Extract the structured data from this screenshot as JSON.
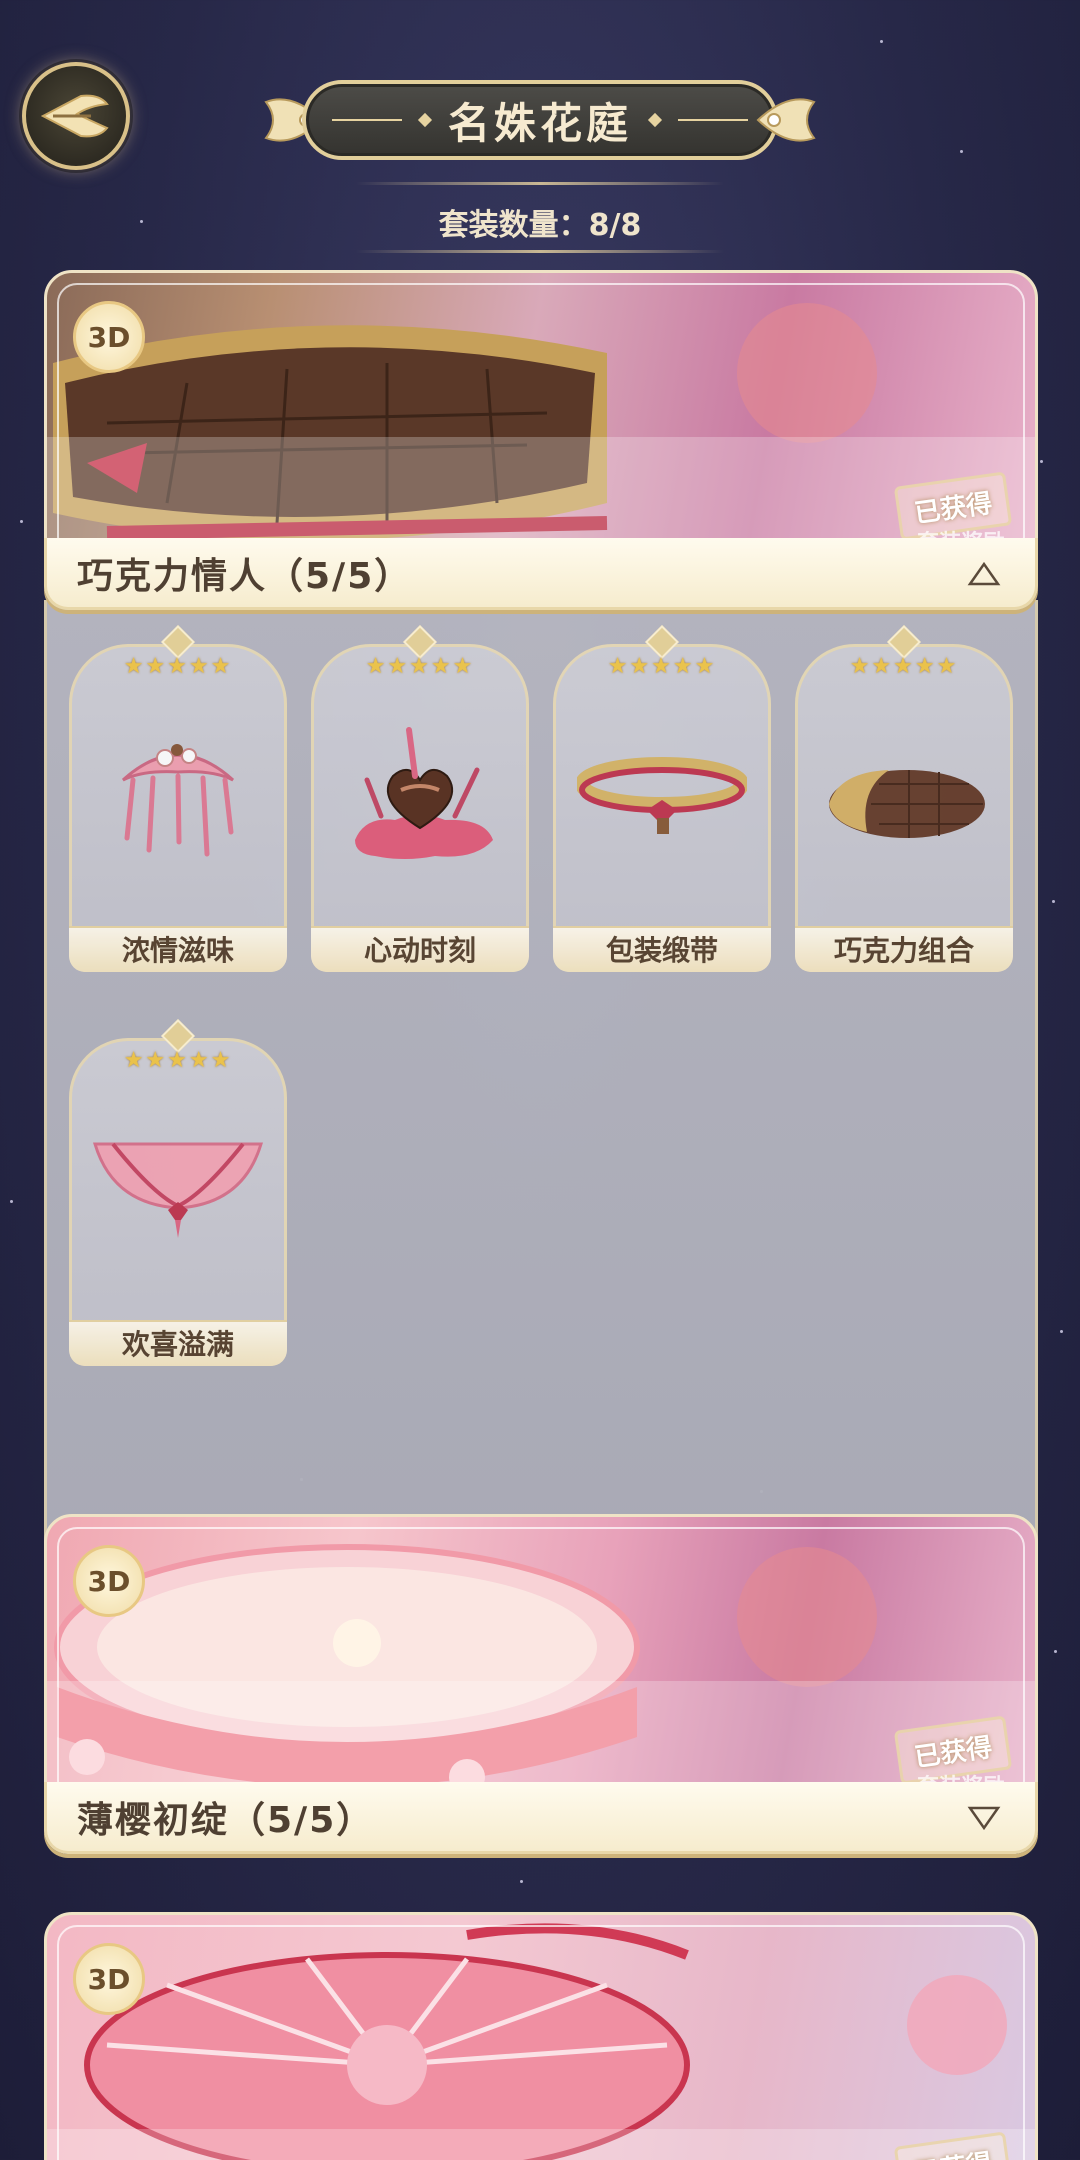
{
  "header": {
    "back_icon": "back-wing-icon",
    "title": "名姝花庭",
    "count_text": "套装数量：8/8"
  },
  "suits": [
    {
      "badge": "3D",
      "name": "巧克力情人（5/5）",
      "obtained": "已获得",
      "reward": "套装奖励",
      "expanded": true,
      "toggle_icon": "collapse-triangle-up-icon",
      "items": [
        {
          "name": "浓情滋味",
          "stars": "★★★★★"
        },
        {
          "name": "心动时刻",
          "stars": "★★★★★"
        },
        {
          "name": "包装缎带",
          "stars": "★★★★★"
        },
        {
          "name": "巧克力组合",
          "stars": "★★★★★"
        },
        {
          "name": "欢喜溢满",
          "stars": "★★★★★"
        }
      ]
    },
    {
      "badge": "3D",
      "name": "薄樱初绽（5/5）",
      "obtained": "已获得",
      "reward": "套装奖励",
      "expanded": false,
      "toggle_icon": "expand-triangle-down-icon"
    },
    {
      "badge": "3D",
      "obtained": "已获得"
    }
  ],
  "colors": {
    "background": "#272848",
    "gold_accent": "#e2cf9b",
    "name_bar": "#f6ecce",
    "panel": "#b3b3bd",
    "star": "#f2c94c"
  }
}
